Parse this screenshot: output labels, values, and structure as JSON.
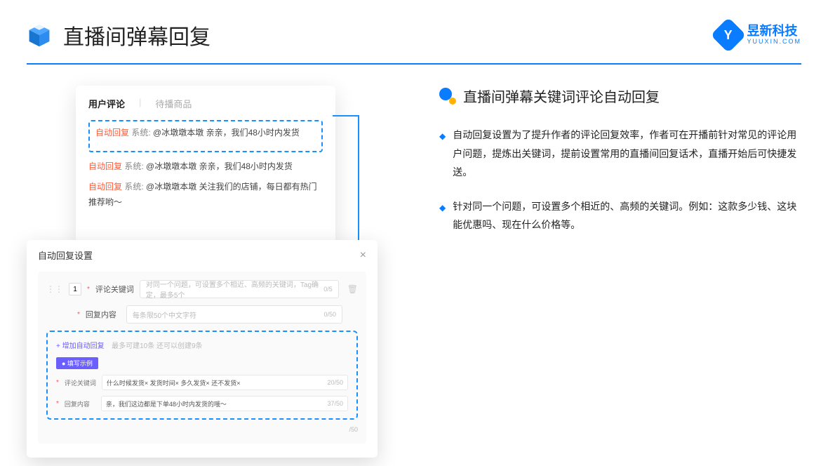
{
  "header": {
    "title": "直播间弹幕回复",
    "brand_cn": "昱新科技",
    "brand_en": "YUUXIN.COM"
  },
  "comments_card": {
    "tab1": "用户评论",
    "tab2": "待播商品",
    "c1_tag": "自动回复",
    "c1_sys": "系统:",
    "c1_text": "@冰墩墩本墩 亲亲，我们48小时内发货",
    "c2_tag": "自动回复",
    "c2_sys": "系统:",
    "c2_text": "@冰墩墩本墩 亲亲，我们48小时内发货",
    "c3_tag": "自动回复",
    "c3_sys": "系统:",
    "c3_text": "@冰墩墩本墩 关注我们的店铺，每日都有热门推荐哟～"
  },
  "settings_card": {
    "title": "自动回复设置",
    "num": "1",
    "kw_label": "评论关键词",
    "kw_placeholder": "对同一个问题，可设置多个相近、高频的关键词，Tag确定，最多5个",
    "kw_count": "0/5",
    "reply_label": "回复内容",
    "reply_placeholder": "每条限50个中文字符",
    "reply_count": "0/50",
    "add_link": "+ 增加自动回复",
    "add_hint": "最多可建10条 还可以创建9条",
    "example_badge": "● 填写示例",
    "ex_kw_label": "评论关键词",
    "ex_kw_chips": "什么时候发货× 发货时间× 多久发货× 还不发货×",
    "ex_kw_count": "20/50",
    "ex_reply_label": "回复内容",
    "ex_reply_text": "亲，我们这边都是下单48小时内发货的哦～",
    "ex_reply_count": "37/50",
    "out_count": "/50"
  },
  "right": {
    "section_title": "直播间弹幕关键词评论自动回复",
    "b1": "自动回复设置为了提升作者的评论回复效率，作者可在开播前针对常见的评论用户问题，提炼出关键词，提前设置常用的直播间回复话术，直播开始后可快捷发送。",
    "b2": "针对同一个问题，可设置多个相近的、高频的关键词。例如：这款多少钱、这块能优惠吗、现在什么价格等。"
  }
}
